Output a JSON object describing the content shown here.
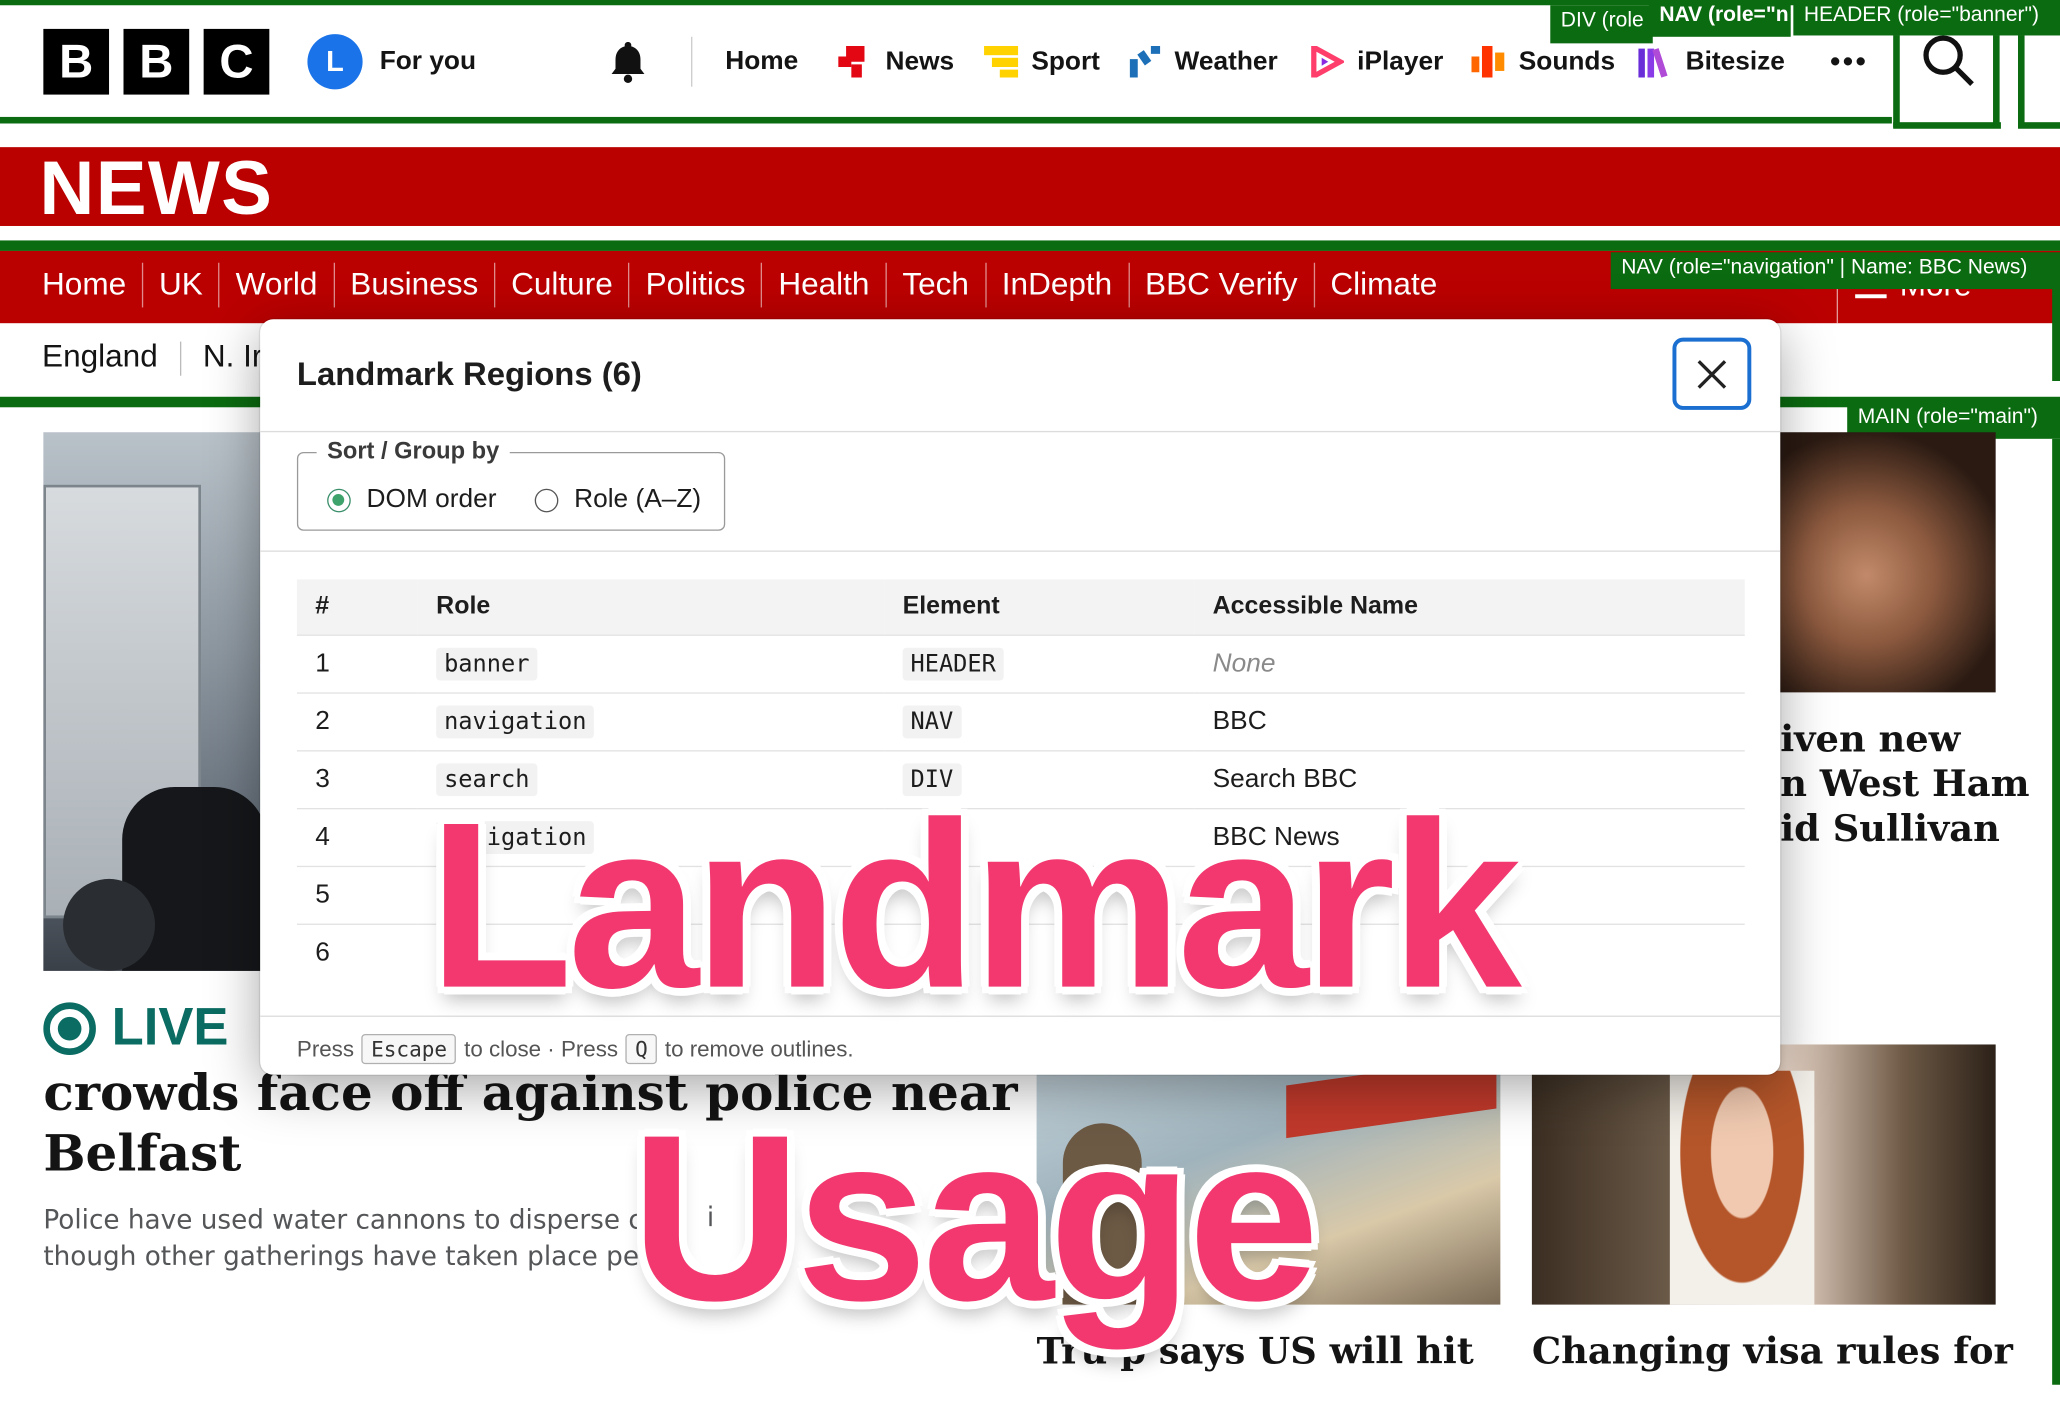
{
  "header": {
    "logo_letters": [
      "B",
      "B",
      "C"
    ],
    "avatar_letter": "L",
    "for_you": "For you",
    "nav": [
      "Home",
      "News",
      "Sport",
      "Weather",
      "iPlayer",
      "Sounds",
      "Bitesize"
    ],
    "more_dots": "•••",
    "colors": {
      "news_icon": "#e30613",
      "sport_icon": "#ffd200",
      "weather_icon": "#1d70b8",
      "iplayer_icon": "#ff3e6c",
      "sounds_icon": "#ff6600",
      "bitesize_icon": "#6a2ed8"
    }
  },
  "outline_tags": {
    "div": "DIV (role",
    "nav_top": "NAV (role=\"n",
    "header": "HEADER (role=\"banner\")",
    "nav_news": "NAV (role=\"navigation\" | Name: BBC News)",
    "main": "MAIN (role=\"main\")",
    "outline_color": "#0b6b10"
  },
  "news_banner": {
    "title": "NEWS",
    "color": "#bb0000"
  },
  "section_nav": [
    "Home",
    "UK",
    "World",
    "Business",
    "Culture",
    "Politics",
    "Health",
    "Tech",
    "InDepth",
    "BBC Verify",
    "Climate"
  ],
  "more_label": "More",
  "sub_nav": [
    "England",
    "N. Ir"
  ],
  "story": {
    "live_label": "LIVE",
    "live_fragment": "",
    "headline_line1": "crowds face off against police near",
    "headline_line2": "Belfast",
    "summary_line1": "Police have used water cannons to disperse c",
    "summary_line2": "though other gatherings have taken place pe",
    "summary_frag": "i"
  },
  "side_story": {
    "line1": "iven new",
    "line2": "n West Ham",
    "line3": "id Sullivan"
  },
  "bottom_stories": {
    "left": "Tru  p says US will hit",
    "right": "Changing visa rules for"
  },
  "modal": {
    "title": "Landmark Regions (6)",
    "sort_legend": "Sort / Group by",
    "options": [
      {
        "label": "DOM order",
        "selected": true
      },
      {
        "label": "Role (A–Z)",
        "selected": false
      }
    ],
    "columns": [
      "#",
      "Role",
      "Element",
      "Accessible Name"
    ],
    "rows": [
      {
        "n": "1",
        "role": "banner",
        "element": "HEADER",
        "name": "None"
      },
      {
        "n": "2",
        "role": "navigation",
        "element": "NAV",
        "name": "BBC"
      },
      {
        "n": "3",
        "role": "search",
        "element": "DIV",
        "name": "Search BBC"
      },
      {
        "n": "4",
        "role": "navigation",
        "element": "",
        "name": "BBC News"
      },
      {
        "n": "5",
        "role": "",
        "element": "",
        "name": ""
      },
      {
        "n": "6",
        "role": "",
        "element": "",
        "name": ""
      }
    ],
    "footer_press": "Press",
    "footer_escape": "Escape",
    "footer_close": "to close · Press",
    "footer_q": "Q",
    "footer_remove": "to remove outlines."
  },
  "overlay": {
    "word1": "Landmark",
    "word2": "Usage",
    "color": "#f2386f"
  }
}
